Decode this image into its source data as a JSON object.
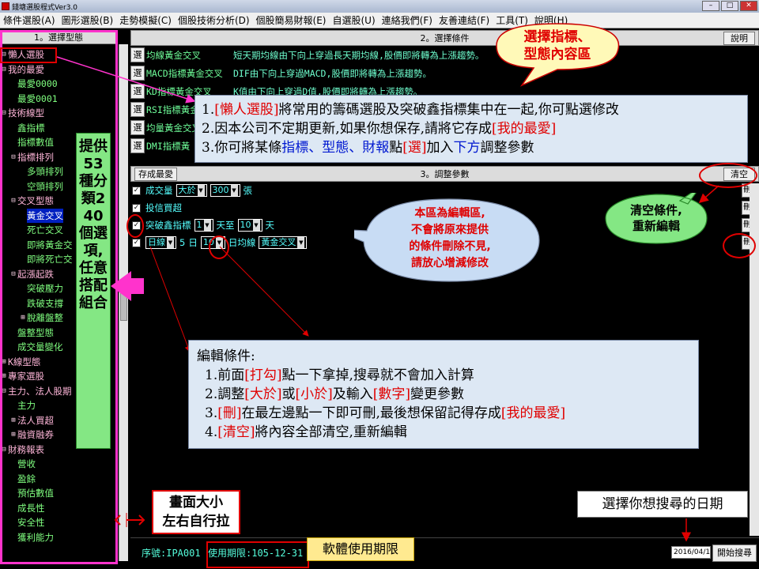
{
  "window": {
    "title": "錢塘選股程式Ver3.0"
  },
  "menu": [
    "條件選股(A)",
    "圖形選股(B)",
    "走勢模擬(C)",
    "個股技術分析(D)",
    "個股簡易財報(E)",
    "自選股(U)",
    "連絡我們(F)",
    "友善連結(F)",
    "工具(T)",
    "說明(H)"
  ],
  "left_panel": {
    "header": "1。選擇型態",
    "tree": [
      {
        "label": "懶人選股",
        "level": 0,
        "toggle": "⊟"
      },
      {
        "label": "我的最愛",
        "level": 0,
        "toggle": "⊟"
      },
      {
        "label": "最愛0000",
        "level": 1,
        "toggle": ""
      },
      {
        "label": "最愛0001",
        "level": 1,
        "toggle": ""
      },
      {
        "label": "技術線型",
        "level": 0,
        "toggle": "⊟"
      },
      {
        "label": "鑫指標",
        "level": 1,
        "toggle": ""
      },
      {
        "label": "指標數值",
        "level": 1,
        "toggle": ""
      },
      {
        "label": "指標排列",
        "level": 1,
        "toggle": "⊟"
      },
      {
        "label": "多頭排列",
        "level": 2,
        "toggle": ""
      },
      {
        "label": "空頭排列",
        "level": 2,
        "toggle": ""
      },
      {
        "label": "交叉型態",
        "level": 1,
        "toggle": "⊟"
      },
      {
        "label": "黃金交叉",
        "level": 2,
        "toggle": "",
        "selected": true
      },
      {
        "label": "死亡交叉",
        "level": 2,
        "toggle": ""
      },
      {
        "label": "即將黃金交",
        "level": 2,
        "toggle": ""
      },
      {
        "label": "即將死亡交",
        "level": 2,
        "toggle": ""
      },
      {
        "label": "起漲起跌",
        "level": 1,
        "toggle": "⊟"
      },
      {
        "label": "突破壓力",
        "level": 2,
        "toggle": ""
      },
      {
        "label": "跌破支撐",
        "level": 2,
        "toggle": ""
      },
      {
        "label": "脫離盤整",
        "level": 2,
        "toggle": "⊞"
      },
      {
        "label": "盤整型態",
        "level": 1,
        "toggle": ""
      },
      {
        "label": "成交量變化",
        "level": 1,
        "toggle": ""
      },
      {
        "label": "K線型態",
        "level": 0,
        "toggle": "⊞"
      },
      {
        "label": "專家選股",
        "level": 0,
        "toggle": "⊞"
      },
      {
        "label": "主力、法人股期",
        "level": 0,
        "toggle": "⊟"
      },
      {
        "label": "主力",
        "level": 1,
        "toggle": ""
      },
      {
        "label": "法人買超",
        "level": 1,
        "toggle": "⊞"
      },
      {
        "label": "融資融券",
        "level": 1,
        "toggle": "⊞"
      },
      {
        "label": "財務報表",
        "level": 0,
        "toggle": "⊟"
      },
      {
        "label": "營收",
        "level": 1,
        "toggle": ""
      },
      {
        "label": "盈餘",
        "level": 1,
        "toggle": ""
      },
      {
        "label": "預估數值",
        "level": 1,
        "toggle": ""
      },
      {
        "label": "成長性",
        "level": 1,
        "toggle": ""
      },
      {
        "label": "安全性",
        "level": 1,
        "toggle": ""
      },
      {
        "label": "獲利能力",
        "level": 1,
        "toggle": ""
      }
    ]
  },
  "cond_panel": {
    "header": "2。選擇條件",
    "help_button": "說明",
    "select_label": "選",
    "rows": [
      {
        "name": "均線黃金交叉",
        "desc": "短天期均線由下向上穿過長天期均線,股價即將轉為上漲趨勢。"
      },
      {
        "name": "MACD指標黃金交叉",
        "desc": "DIF由下向上穿過MACD,股價即將轉為上漲趨勢。"
      },
      {
        "name": "KD指標黃金交叉",
        "desc": "K值由下向上穿過D值,股價即將轉為上漲趨勢。"
      },
      {
        "name": "RSI指標黃金",
        "desc": ""
      },
      {
        "name": "均量黃金交叉",
        "desc": ""
      },
      {
        "name": "DMI指標黃",
        "desc": ""
      }
    ]
  },
  "edit_panel": {
    "header": "3。調整參數",
    "save_button": "存成最愛",
    "clear_button": "清空",
    "delete_label": "刪",
    "rows": [
      {
        "parts": [
          "成交量",
          "大於",
          "300",
          "張"
        ]
      },
      {
        "parts": [
          "投信買超"
        ]
      },
      {
        "parts": [
          "突破鑫指標",
          "1",
          "天至",
          "10",
          "天"
        ]
      },
      {
        "parts": [
          "日線",
          "5",
          "日",
          "10",
          "日均線",
          "黃金交叉"
        ]
      }
    ]
  },
  "bottom": {
    "serial": "序號:IPA001",
    "expiry": "使用期限:105-12-31",
    "date": "2016/04/11",
    "start_button": "開始搜尋"
  },
  "annotations": {
    "bubble_select": [
      "選擇指標、",
      "型態內容區"
    ],
    "info_top": [
      [
        {
          "t": "1."
        },
        {
          "t": "[懶人選股]",
          "c": "r"
        },
        {
          "t": "將常用的籌碼選股及突破鑫指標集中在一起,你可點選修改"
        }
      ],
      [
        {
          "t": "2.因本公司不定期更新,如果你想保存,請將它存成"
        },
        {
          "t": "[我的最愛]",
          "c": "r"
        }
      ],
      [
        {
          "t": "3.你可將某條"
        },
        {
          "t": "指標、型態、財報",
          "c": "b"
        },
        {
          "t": "點"
        },
        {
          "t": "[選]",
          "c": "r"
        },
        {
          "t": "加入"
        },
        {
          "t": "下方",
          "c": "b"
        },
        {
          "t": "調整參數"
        }
      ]
    ],
    "left_vertical": "提供53種分類240個選項,任意搭配組合",
    "bubble_edit": [
      "本區為編輯區,",
      "不會將原來提供",
      "的條件刪除不見,",
      "請放心增減修改"
    ],
    "bubble_clear": [
      "清空條件,",
      "重新編輯"
    ],
    "info_edit_title": "編輯條件:",
    "info_edit": [
      [
        {
          "t": "1.前面"
        },
        {
          "t": "[打勾]",
          "c": "r"
        },
        {
          "t": "點一下拿掉,搜尋就不會加入計算"
        }
      ],
      [
        {
          "t": "2.調整"
        },
        {
          "t": "[大於]",
          "c": "r"
        },
        {
          "t": "或"
        },
        {
          "t": "[小於]",
          "c": "r"
        },
        {
          "t": "及輸入"
        },
        {
          "t": "[數字]",
          "c": "r"
        },
        {
          "t": "變更參數"
        }
      ],
      [
        {
          "t": "3."
        },
        {
          "t": "[刪]",
          "c": "r"
        },
        {
          "t": "在最左邊點一下即可刪,最後想保留記得存成"
        },
        {
          "t": "[我的最愛]",
          "c": "r"
        }
      ],
      [
        {
          "t": "4."
        },
        {
          "t": "[清空]",
          "c": "r"
        },
        {
          "t": "將內容全部清空,重新編輯"
        }
      ]
    ],
    "resize_note": [
      "畫面大小",
      "左右自行拉"
    ],
    "date_note": "選擇你想搜尋的日期",
    "expiry_note": "軟體使用期限"
  }
}
